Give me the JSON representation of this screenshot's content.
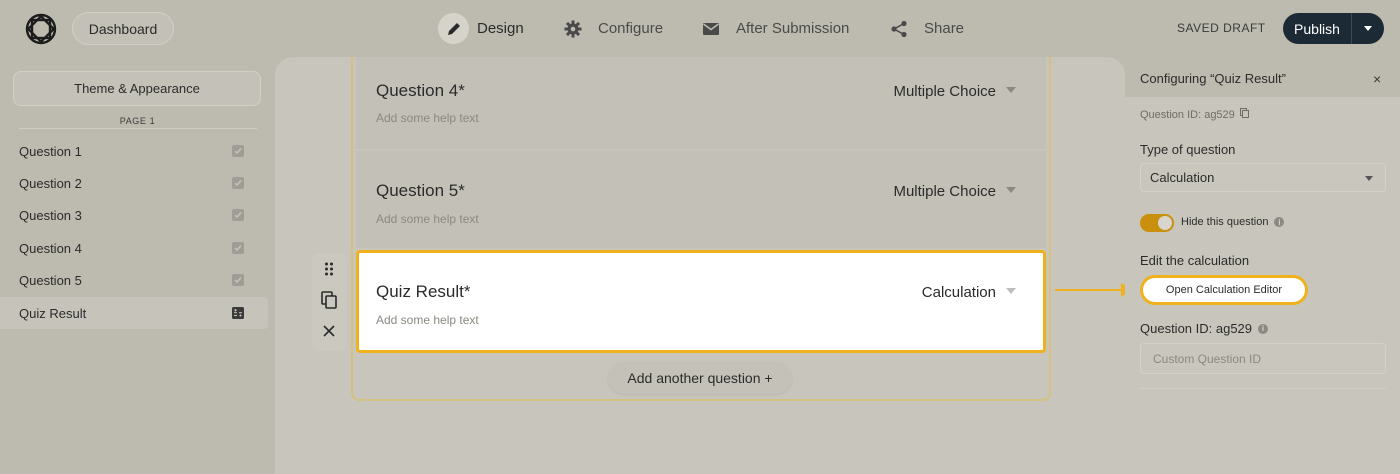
{
  "header": {
    "dashboard_label": "Dashboard",
    "nav": [
      {
        "label": "Design",
        "icon": "pencil-icon"
      },
      {
        "label": "Configure",
        "icon": "gear-icon"
      },
      {
        "label": "After Submission",
        "icon": "envelope-icon"
      },
      {
        "label": "Share",
        "icon": "share-icon"
      }
    ],
    "saved_status": "SAVED DRAFT",
    "publish_label": "Publish"
  },
  "sidebar": {
    "theme_label": "Theme & Appearance",
    "page_label": "PAGE 1",
    "items": [
      {
        "label": "Question 1",
        "icon": "checkbox-icon"
      },
      {
        "label": "Question 2",
        "icon": "checkbox-icon"
      },
      {
        "label": "Question 3",
        "icon": "checkbox-icon"
      },
      {
        "label": "Question 4",
        "icon": "checkbox-icon"
      },
      {
        "label": "Question 5",
        "icon": "checkbox-icon"
      },
      {
        "label": "Quiz Result",
        "icon": "calculator-icon"
      }
    ]
  },
  "canvas": {
    "questions": [
      {
        "title": "Question 4*",
        "help": "Add some help text",
        "type": "Multiple Choice"
      },
      {
        "title": "Question 5*",
        "help": "Add some help text",
        "type": "Multiple Choice"
      },
      {
        "title": "Quiz Result*",
        "help": "Add some help text",
        "type": "Calculation"
      }
    ],
    "add_question_label": "Add another question +"
  },
  "panel": {
    "title": "Configuring “Quiz Result”",
    "close": "×",
    "question_id_text": "Question ID: ag529",
    "type_label": "Type of question",
    "type_value": "Calculation",
    "hide_label": "Hide this question",
    "hide_enabled": true,
    "edit_calc_label": "Edit the calculation",
    "calc_button": "Open Calculation Editor",
    "qid_label": "Question ID: ag529",
    "custom_id_placeholder": "Custom Question ID"
  },
  "colors": {
    "accent": "#f0b11e",
    "publish_bg": "#1c2a35",
    "toggle_on": "#c8900c"
  }
}
